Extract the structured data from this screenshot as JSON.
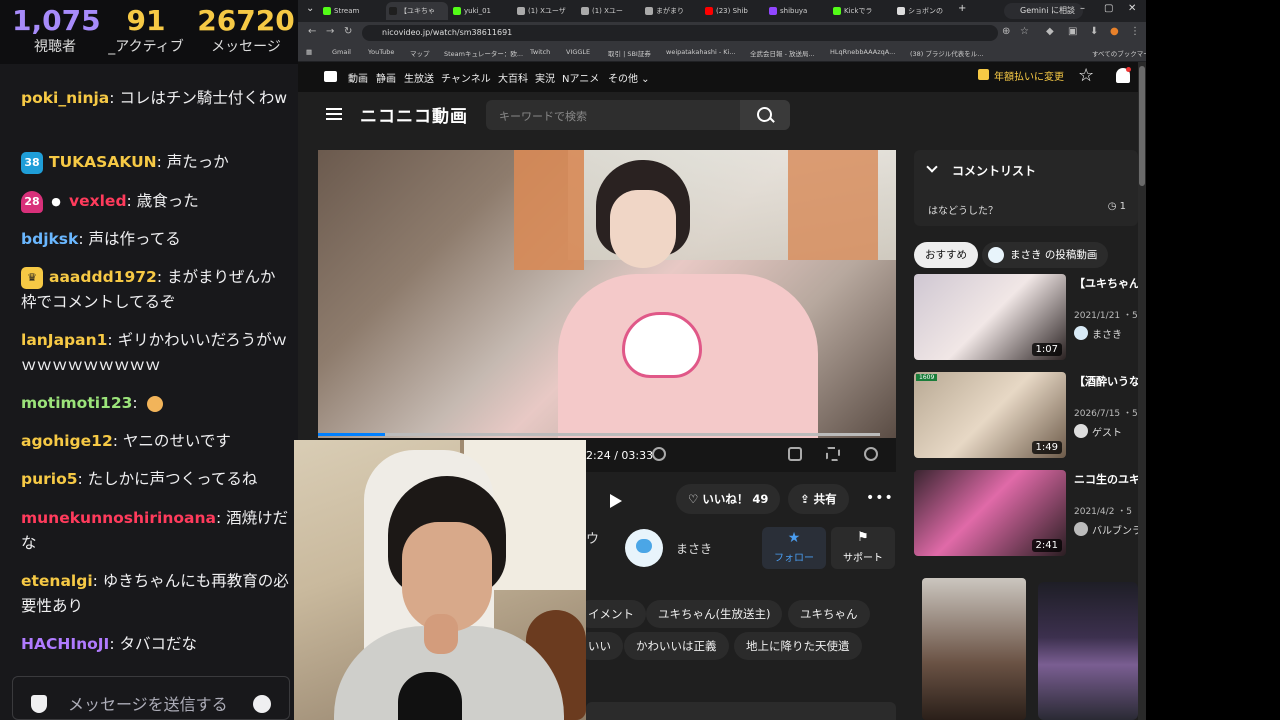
{
  "stats": {
    "viewers": {
      "value": "1,075",
      "label": "視聴者"
    },
    "active": {
      "value": "91",
      "label": "_アクティブ"
    },
    "messages": {
      "value": "26720",
      "label": "メッセージ"
    }
  },
  "chat": {
    "messages": [
      {
        "user": "poki_ninja",
        "color": "#f6c945",
        "text": ": コレはチン騎士付くわw",
        "badge": ""
      },
      {
        "user": "TUKASAKUN",
        "color": "#f6c945",
        "text": ": 声たっか",
        "badge": "38"
      },
      {
        "user": "vexled",
        "color": "#ff3b5c",
        "text": ": 歳食った",
        "badge": "28"
      },
      {
        "user": "bdjksk",
        "color": "#6ab7ff",
        "text": ": 声は作ってる",
        "badge": ""
      },
      {
        "user": "aaaddd1972",
        "color": "#f6c945",
        "text": ": まがまりぜんか枠でコメントしてるぞ",
        "badge": "crown"
      },
      {
        "user": "lanJapan1",
        "color": "#f6c945",
        "text": ": ギリかわいいだろうがｗｗｗｗｗｗｗｗｗｗ",
        "badge": ""
      },
      {
        "user": "motimoti123",
        "color": "#9be37a",
        "text": ":",
        "badge": ""
      },
      {
        "user": "agohige12",
        "color": "#f6c945",
        "text": ": ヤニのせいです",
        "badge": ""
      },
      {
        "user": "purio5",
        "color": "#f6c945",
        "text": ": たしかに声つくってるね",
        "badge": ""
      },
      {
        "user": "munekunnoshirinoana",
        "color": "#ff3b5c",
        "text": ": 酒焼けだな",
        "badge": ""
      },
      {
        "user": "etenalgi",
        "color": "#f6c945",
        "text": ": ゆきちゃんにも再教育の必要性あり",
        "badge": ""
      },
      {
        "user": "HACHInoJI",
        "color": "#b07bff",
        "text": ": タバコだな",
        "badge": ""
      }
    ],
    "input_placeholder": "メッセージを送信する"
  },
  "browser": {
    "tabs": [
      {
        "label": "Stream",
        "color": "#53fc18"
      },
      {
        "label": "【ユキちゃ",
        "color": "#1f1f1f"
      },
      {
        "label": "yuki_01",
        "color": "#53fc18"
      },
      {
        "label": "(1) Xユーザ",
        "color": "#111"
      },
      {
        "label": "(1) Xユー",
        "color": "#111"
      },
      {
        "label": "まがまり",
        "color": "#111"
      },
      {
        "label": "(23) Shib",
        "color": "#ff0000"
      },
      {
        "label": "shibuya",
        "color": "#9146ff"
      },
      {
        "label": "Kickでラ",
        "color": "#53fc18"
      },
      {
        "label": "ショボンの",
        "color": "#ddd"
      }
    ],
    "gemini": "Gemini に相談",
    "url": "nicovideo.jp/watch/sm38611691",
    "bookmarks": [
      "Gmail",
      "YouTube",
      "マップ",
      "Steamキュレーター：欧...",
      "Twitch",
      "VIGGLE",
      "取引 | SBI証券",
      "weipatakahashi - Ki...",
      "全武会日報 - 放送局...",
      "HLqRnebbAAAzqA...",
      "(38) ブラジル代表をル...",
      "すべてのブックマーク"
    ]
  },
  "nico": {
    "nav": [
      "動画",
      "静画",
      "生放送",
      "チャンネル",
      "大百科",
      "実況",
      "Nアニメ",
      "その他 ⌄"
    ],
    "premium": "年額払いに変更",
    "logo": "ニコニコ動画",
    "search_placeholder": "キーワードで検索",
    "time": "2:24 / 03:33",
    "progress": 0.12,
    "like": "いいね！ 49",
    "share": "共有",
    "owner": "まさき",
    "follow": "フォロー",
    "support": "サポート",
    "partial_text": "ウ",
    "tags_row1": [
      "イメント",
      "ユキちゃん(生放送主)",
      "ユキちゃん"
    ],
    "tags_row2": [
      "いい",
      "かわいいは正義",
      "地上に降りた天使遺"
    ],
    "comment_list": {
      "title": "コメントリスト",
      "latest": "はなどうした？",
      "count": "1"
    },
    "chips": {
      "recommended": "おすすめ",
      "owner_videos": "まさき の投稿動画"
    },
    "related": [
      {
        "title": "【ユキちゃん 時16分に赤ち",
        "date": "2021/1/21 ・5",
        "channel": "まさき",
        "duration": "1:07"
      },
      {
        "title": "【酒酔いうな 好きだよ」し",
        "date": "2026/7/15 ・5",
        "channel": "ゲスト",
        "duration": "1:49",
        "level": "1609"
      },
      {
        "title": "ニコ生のユキ",
        "date": "2021/4/2 ・5",
        "channel": "バルブンラ",
        "duration": "2:41"
      }
    ]
  }
}
